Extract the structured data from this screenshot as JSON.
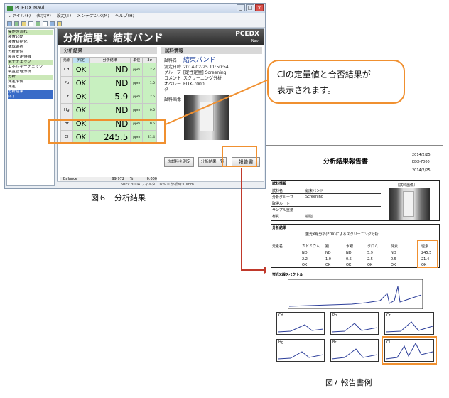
{
  "window": {
    "title": "PCEDX Navi",
    "menu": [
      "ファイル(F)",
      "表示(V)",
      "設定(T)",
      "メンテナンス(M)",
      "ヘルプ(H)"
    ]
  },
  "tree": [
    "操作の流れ",
    "装置起動",
    "装置初期化",
    "構成選択",
    "分析条件",
    "装置安定待機",
    "電子チェック",
    "エネルギーチェック",
    "装置管理分析",
    "分析",
    "測定準備",
    "測定",
    "分析結果",
    "終了"
  ],
  "banner": {
    "title": "分析結果：結束バンド",
    "brand": "PCEDX",
    "brand_sub": "Navi"
  },
  "results": {
    "section": "分析結果",
    "headers": [
      "元素",
      "判定",
      "分析結果",
      "単位",
      "3σ"
    ],
    "rows": [
      {
        "el": "Cd",
        "judge": "OK",
        "value": "ND",
        "unit": "ppm",
        "sigma": "2.2"
      },
      {
        "el": "Pb",
        "judge": "OK",
        "value": "ND",
        "unit": "ppm",
        "sigma": "1.0"
      },
      {
        "el": "Cr",
        "judge": "OK",
        "value": "5.9",
        "unit": "ppm",
        "sigma": "2.5"
      },
      {
        "el": "Hg",
        "judge": "OK",
        "value": "ND",
        "unit": "ppm",
        "sigma": "0.5"
      },
      {
        "el": "Br",
        "judge": "OK",
        "value": "ND",
        "unit": "ppm",
        "sigma": "0.5"
      },
      {
        "el": "Cl",
        "judge": "OK",
        "value": "245.5",
        "unit": "ppm",
        "sigma": "21.4"
      }
    ],
    "balance": {
      "label": "Balance",
      "value": "99.972",
      "unit": "%",
      "sigma": "0.000"
    }
  },
  "info": {
    "section": "試料情報",
    "rows": [
      {
        "k": "試料名",
        "v": "結束バンド"
      },
      {
        "k": "測定日時",
        "v": "2014-02-25 11:50:54"
      },
      {
        "k": "グループ",
        "v": "[定性定量] Screening"
      },
      {
        "k": "コメント",
        "v": "スクリーニング分析"
      },
      {
        "k": "オペレータ",
        "v": "EDX-7000"
      }
    ],
    "image_label": "試料画像"
  },
  "buttons": {
    "next": "次試料を測定",
    "list": "分析結果一覧",
    "report": "報告書"
  },
  "status": "50kV  30uA  フィルタ: D7%  0 分析時:10mm",
  "callout": {
    "line1": "Clの定量値と合否結果が",
    "line2": "表示されます。"
  },
  "captions": {
    "fig6": "図６　分析結果",
    "fig7": "図7 報告書例"
  },
  "report": {
    "title": "分析結果報告書",
    "date": "2014/2/25",
    "operator": "EDX-7000",
    "sample_section": "試料情報",
    "sample_rows": [
      "試料名",
      "分析グループ",
      "取得ルート",
      "サンプル重量",
      "材質"
    ],
    "sample_values": [
      "結束バンド",
      "Screening",
      "",
      "",
      "樹脂"
    ],
    "photo_label": "［試料画像］",
    "analysis_section": "分析結果",
    "method": "蛍光X線分析(EDX)によるスクリーニング分析",
    "cols": [
      "元素名",
      "カドミウム",
      "鉛",
      "水銀",
      "クロム",
      "臭素",
      "塩素"
    ],
    "quant": [
      "ND",
      "ND",
      "ND",
      "5.9",
      "ND",
      "245.5"
    ],
    "det": [
      "2.2",
      "1.0",
      "0.5",
      "2.5",
      "0.5",
      "21.4"
    ],
    "judge": [
      "OK",
      "OK",
      "OK",
      "OK",
      "OK",
      "OK"
    ],
    "spectrum_label": "蛍光X線スペクトル",
    "mini_labels": [
      "Cd",
      "Pb",
      "Cr",
      "Hg",
      "Br",
      "Cl"
    ]
  },
  "colors": {
    "highlight": "#f09030",
    "ok_bg": "#c8f0c0",
    "arrow": "#c0392b"
  }
}
